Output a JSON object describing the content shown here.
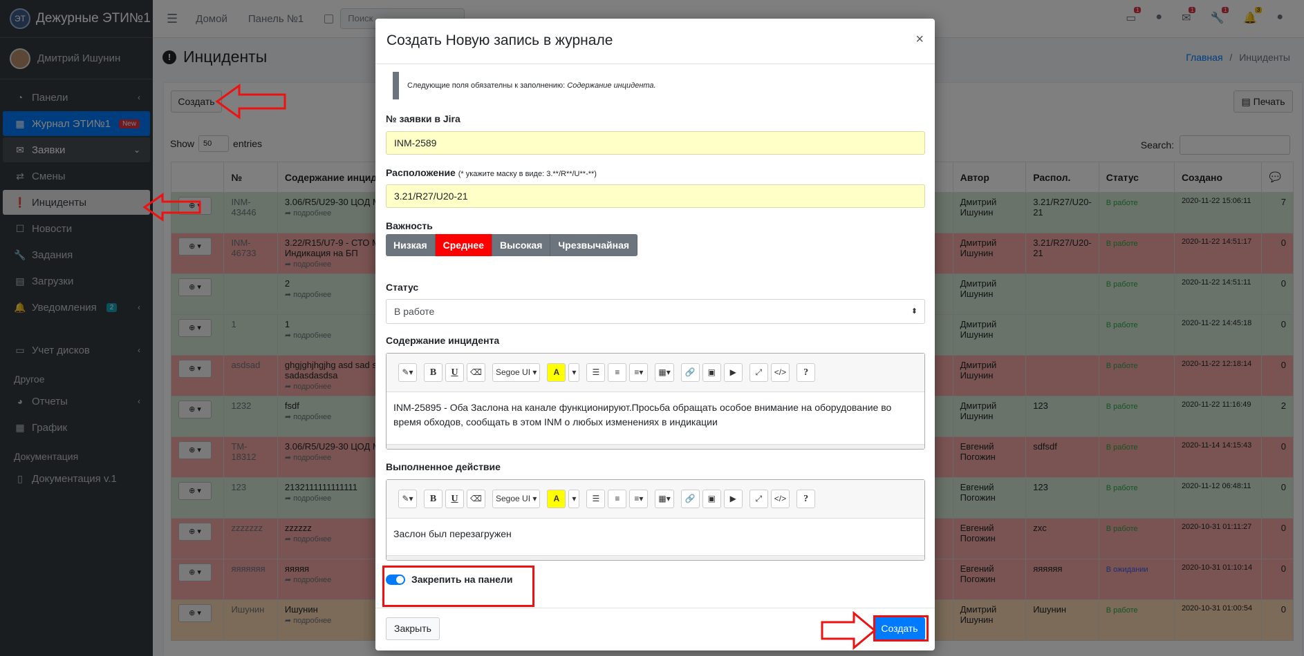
{
  "brand": {
    "logo": "ЭТ",
    "name": "Дежурные ЭТИ№1"
  },
  "user": {
    "name": "Дмитрий Ишунин"
  },
  "sidebar": {
    "items": [
      {
        "label": "Панели",
        "icon": "dashboard-icon",
        "glyph": "◔",
        "arrow": "‹"
      },
      {
        "label": "Журнал ЭТИ№1",
        "icon": "table-icon",
        "glyph": "▦",
        "badge": "New"
      },
      {
        "label": "Заявки",
        "icon": "envelope-icon",
        "glyph": "✉",
        "arrow": "⌄"
      },
      {
        "label": "Смены",
        "icon": "exchange-icon",
        "glyph": "⇄"
      },
      {
        "label": "Инциденты",
        "icon": "exclamation-icon",
        "glyph": "❗"
      },
      {
        "label": "Новости",
        "icon": "news-icon",
        "glyph": "☐"
      },
      {
        "label": "Задания",
        "icon": "wrench-icon",
        "glyph": "🔧"
      },
      {
        "label": "Загрузки",
        "icon": "file-icon",
        "glyph": "▤"
      },
      {
        "label": "Уведомления",
        "icon": "bell-icon",
        "glyph": "🔔",
        "badge": "2",
        "arrow": "‹"
      },
      {
        "label": "Учет дисков",
        "icon": "hdd-icon",
        "glyph": "▭",
        "arrow": "‹"
      }
    ],
    "header_other": "Другое",
    "other_items": [
      {
        "label": "Отчеты",
        "icon": "chart-pie-icon",
        "glyph": "◕",
        "arrow": "‹"
      },
      {
        "label": "График",
        "icon": "calendar-icon",
        "glyph": "▦"
      }
    ],
    "header_docs": "Документация",
    "doc_items": [
      {
        "label": "Документация v.1",
        "icon": "document-icon",
        "glyph": "▯"
      }
    ]
  },
  "navbar": {
    "menu_glyph": "☰",
    "home": "Домой",
    "panel": "Панель №1",
    "search_placeholder": "Поиск ...",
    "icons": [
      {
        "name": "hdd-icon",
        "glyph": "▭",
        "badge": "1"
      },
      {
        "name": "exclamation-icon",
        "glyph": "●",
        "badge": ""
      },
      {
        "name": "envelope-open-icon",
        "glyph": "✉",
        "badge": "1"
      },
      {
        "name": "wrench-icon",
        "glyph": "🔧",
        "badge": "1"
      },
      {
        "name": "bell-icon",
        "glyph": "🔔",
        "badge": "3"
      },
      {
        "name": "avatar-icon",
        "glyph": "●",
        "badge": ""
      }
    ]
  },
  "page": {
    "title_glyph": "!",
    "title": "Инциденты",
    "breadcrumb_home": "Главная",
    "breadcrumb_sep": "/",
    "breadcrumb_current": "Инциденты",
    "create_button": "Создать",
    "print_button": "Печать",
    "show_label": "Show",
    "entries_value": "50",
    "entries_label": "entries",
    "search_label": "Search:"
  },
  "table": {
    "columns": [
      "",
      "№",
      "Содержание инцид",
      "Автор",
      "Распол.",
      "Статус",
      "Создано",
      "💬"
    ],
    "rows": [
      {
        "tone": "green",
        "num": "INM-\n43446",
        "content": "3.06/R5/U29-30 ЦОД М",
        "more": "подробнее",
        "author": "Дмитрий\nИшунин",
        "loc": "3.21/R27/U20-\n21",
        "status": "В работе",
        "created": "2020-11-22 15:06:11",
        "count": "7"
      },
      {
        "tone": "red",
        "num": "INM-\n46733",
        "content": "3.22/R15/U7-9 - СТО М\nИндикация на БП",
        "more": "подробнее",
        "author": "Дмитрий\nИшунин",
        "loc": "3.21/R27/U20-\n21",
        "status": "В работе",
        "created": "2020-11-22 14:51:17",
        "count": "0"
      },
      {
        "tone": "green",
        "num": "",
        "content": "2",
        "more": "подробнее",
        "author": "Дмитрий\nИшунин",
        "loc": "",
        "status": "В работе",
        "created": "2020-11-22 14:51:11",
        "count": "0"
      },
      {
        "tone": "green",
        "num": "1",
        "content": "1",
        "more": "подробнее",
        "author": "Дмитрий\nИшунин",
        "loc": "",
        "status": "В работе",
        "created": "2020-11-22 14:45:18",
        "count": "0"
      },
      {
        "tone": "red",
        "num": "asdsad",
        "content": "ghgjghjhgjhg asd sad s\nsadasdasdsa",
        "more": "подробнее",
        "author": "Дмитрий\nИшунин",
        "loc": "",
        "status": "В работе",
        "created": "2020-11-22 12:18:14",
        "count": "0"
      },
      {
        "tone": "green",
        "num": "1232",
        "content": "fsdf",
        "more": "подробнее",
        "author": "Дмитрий\nИшунин",
        "loc": "123",
        "status": "В работе",
        "created": "2020-11-22 11:16:49",
        "count": "2"
      },
      {
        "tone": "red",
        "num": "TM-\n18312",
        "content": "3.06/R5/U29-30 ЦОД М",
        "more": "подробнее",
        "author": "Евгений\nПогожин",
        "loc": "sdfsdf",
        "status": "В работе",
        "created": "2020-11-14 14:15:43",
        "count": "0"
      },
      {
        "tone": "green",
        "num": "123",
        "content": "2132111111111111",
        "more": "подробнее",
        "author": "Евгений\nПогожин",
        "loc": "123",
        "status": "В работе",
        "created": "2020-11-12 06:48:11",
        "count": "0"
      },
      {
        "tone": "red",
        "num": "zzzzzzz",
        "content": "zzzzzz",
        "more": "подробнее",
        "author": "Евгений\nПогожин",
        "loc": "zxc",
        "status": "В работе",
        "created": "2020-10-31 01:11:27",
        "count": "0"
      },
      {
        "tone": "red",
        "num": "яяяяяяя",
        "content": "яяяяя",
        "more": "подробнее",
        "author": "Евгений\nПогожин",
        "loc": "яяяяяя",
        "status": "В ожидании",
        "created": "2020-10-31 01:10:14",
        "count": "0"
      },
      {
        "tone": "orange",
        "num": "Ишунин",
        "content": "Ишунин",
        "more": "подробнее",
        "author": "Дмитрий\nИшунин",
        "loc": "Ишунин",
        "status": "В работе",
        "created": "2020-10-31 01:00:54",
        "count": "0"
      }
    ]
  },
  "modal": {
    "title": "Создать Новую запись в журнале",
    "close_glyph": "×",
    "required_note": "Следующие поля обязателны к заполнению:",
    "required_field": "Содержание инцидента.",
    "jira_label": "№ заявки в Jira",
    "jira_value": "INM-2589",
    "location_label": "Расположение",
    "location_hint": "(* укажите маску в виде: 3.**/R**/U**-**)",
    "location_value": "3.21/R27/U20-21",
    "importance_label": "Важность",
    "importance_options": [
      "Низкая",
      "Среднее",
      "Высокая",
      "Чрезвычайная"
    ],
    "importance_selected": "Среднее",
    "status_label": "Статус",
    "status_value": "В работе",
    "content_label": "Содержание инцидента",
    "content_text": "INM-25895 - Оба Заслона на канале функционируют.Просьба обращать особое внимание на оборудование во время обходов, сообщать в этом INM о любых изменениях в индикации",
    "action_label": "Выполненное действие",
    "action_text": "Заслон был перезагружен",
    "toolbar": {
      "magic": "✎▾",
      "bold": "B",
      "underline": "U",
      "eraser": "⌫",
      "font": "Segoe UI ▾",
      "highlight": "A",
      "highlight_caret": "▾",
      "ul": "☰",
      "ol": "≡",
      "align": "≡▾",
      "table": "▦▾",
      "link": "🔗",
      "picture": "▣",
      "video": "▶",
      "fullscreen": "⤢",
      "code": "</>",
      "help": "?"
    },
    "pin_label": "Закрепить на панели",
    "close_button": "Закрыть",
    "submit_button": "Создать"
  }
}
